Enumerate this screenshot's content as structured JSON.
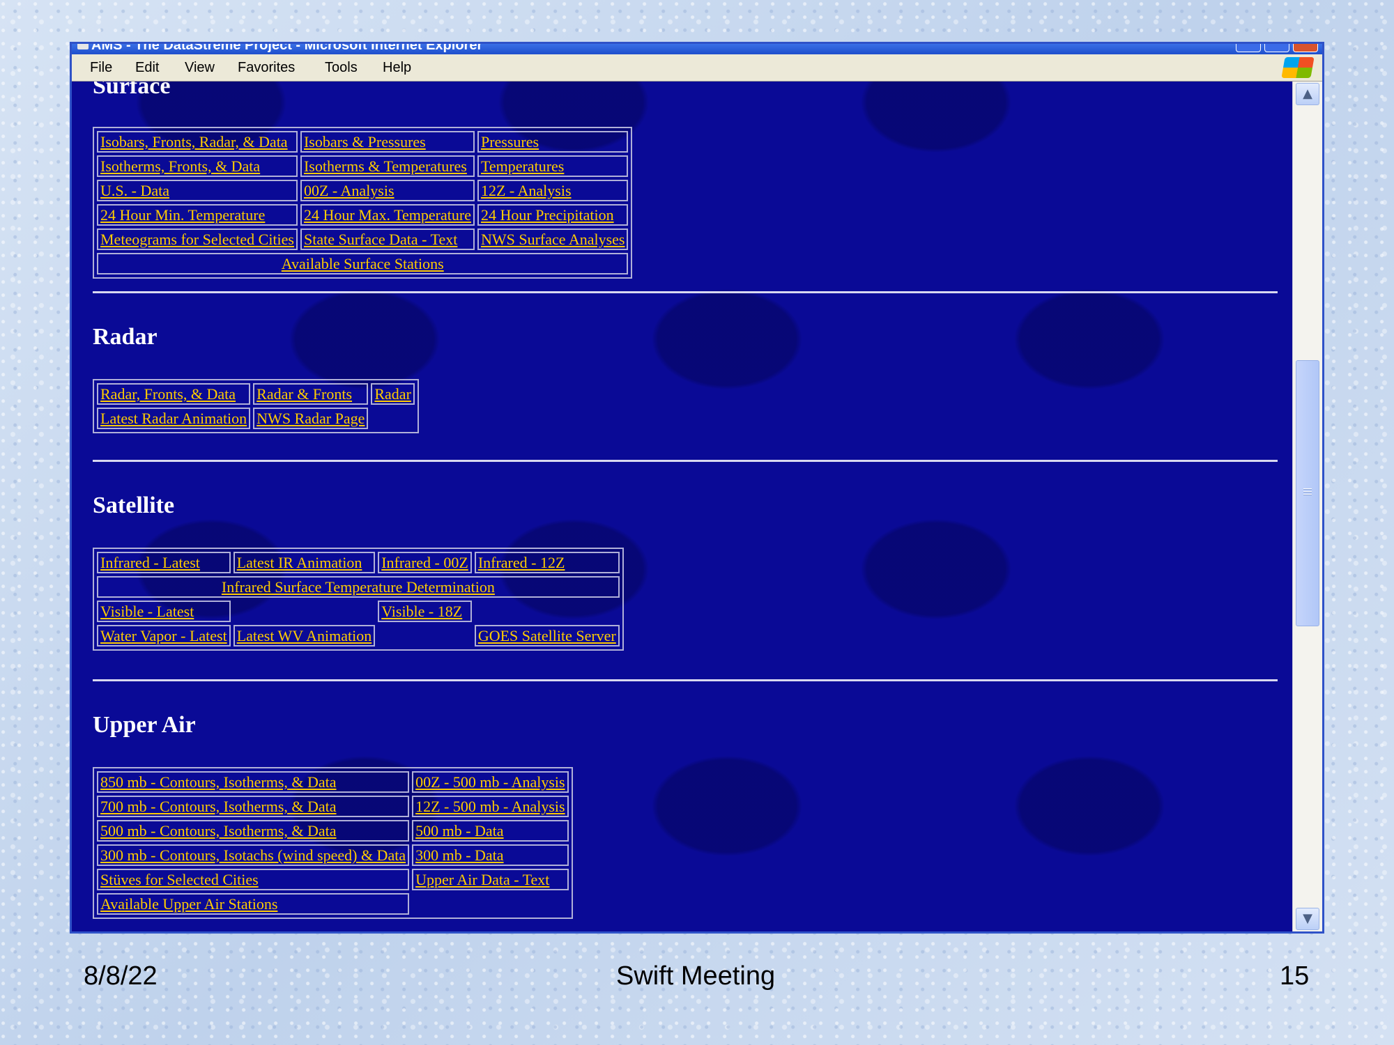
{
  "window": {
    "title": "AMS - The DataStreme Project - Microsoft Internet Explorer"
  },
  "menu": [
    "File",
    "Edit",
    "View",
    "Favorites",
    "Tools",
    "Help"
  ],
  "sections": {
    "surface": {
      "title": "Surface",
      "rows": [
        [
          "Isobars, Fronts, Radar, & Data",
          "Isobars & Pressures",
          "Pressures"
        ],
        [
          "Isotherms, Fronts, & Data",
          "Isotherms & Temperatures",
          "Temperatures"
        ],
        [
          "U.S. - Data",
          "00Z - Analysis",
          "12Z - Analysis"
        ],
        [
          "24 Hour Min. Temperature",
          "24 Hour Max. Temperature",
          "24 Hour Precipitation"
        ],
        [
          "Meteograms for Selected Cities",
          "State Surface Data - Text",
          "NWS Surface Analyses"
        ]
      ],
      "footer_link": "Available Surface Stations"
    },
    "radar": {
      "title": "Radar",
      "rows": [
        [
          "Radar, Fronts, & Data",
          "Radar & Fronts",
          "Radar"
        ],
        [
          "Latest Radar Animation",
          "NWS Radar Page"
        ]
      ]
    },
    "satellite": {
      "title": "Satellite",
      "row1": [
        "Infrared - Latest",
        "Latest IR Animation",
        "Infrared - 00Z",
        "Infrared - 12Z"
      ],
      "wide_link": "Infrared Surface Temperature Determination",
      "visible_latest": "Visible - Latest",
      "visible_18z": "Visible - 18Z",
      "water_vapor_latest": "Water Vapor - Latest",
      "latest_wv_animation": "Latest WV Animation",
      "goes_server": "GOES Satellite Server"
    },
    "upper_air": {
      "title": "Upper Air",
      "rows": [
        [
          "850 mb - Contours, Isotherms, & Data",
          "00Z - 500 mb - Analysis"
        ],
        [
          "700 mb - Contours, Isotherms, & Data",
          "12Z - 500 mb - Analysis"
        ],
        [
          "500 mb - Contours, Isotherms, & Data",
          "500 mb - Data"
        ],
        [
          "300 mb - Contours, Isotachs (wind speed) & Data",
          "300 mb - Data"
        ],
        [
          "Stüves for Selected Cities",
          "Upper Air Data - Text"
        ]
      ],
      "last_link": "Available Upper Air Stations"
    }
  },
  "slide_footer": {
    "date": "8/8/22",
    "title": "Swift Meeting",
    "page": "15"
  },
  "colors": {
    "page_bg": "#0a0a96",
    "link": "#ffcc00",
    "heading": "#ffffff"
  },
  "icons": {
    "scroll_up": "▲",
    "scroll_down": "▼"
  }
}
